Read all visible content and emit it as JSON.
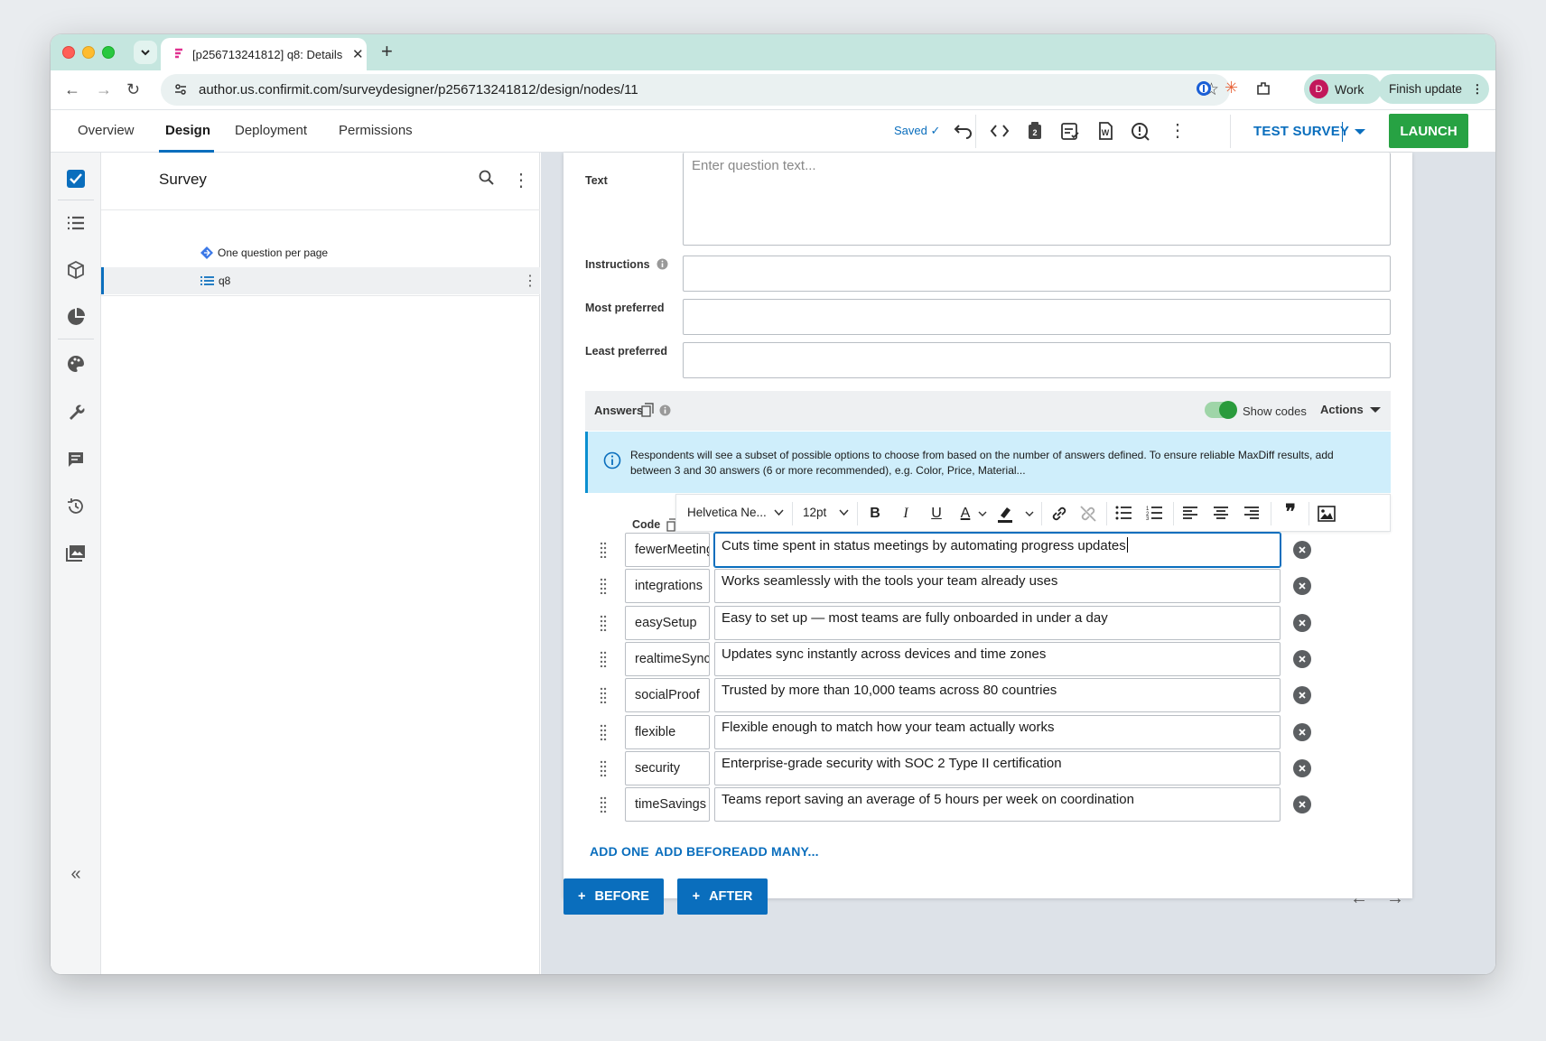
{
  "browser": {
    "tab_title": "[p256713241812] q8: Details",
    "url": "author.us.confirmit.com/surveydesigner/p256713241812/design/nodes/11",
    "profile_initial": "D",
    "profile_label": "Work",
    "finish_update": "Finish update"
  },
  "app": {
    "tabs": [
      "Overview",
      "Design",
      "Deployment",
      "Permissions"
    ],
    "saved": "Saved ✓",
    "test_survey": "TEST SURVEY",
    "launch": "LAUNCH"
  },
  "tree": {
    "title": "Survey",
    "nodes": [
      {
        "label": "One question per page",
        "icon": "page-break-icon"
      },
      {
        "label": "q8",
        "icon": "list-icon"
      }
    ]
  },
  "editor": {
    "fields": [
      {
        "label": "Text",
        "placeholder": "Enter question text..."
      },
      {
        "label": "Instructions",
        "placeholder": ""
      },
      {
        "label": "Most preferred",
        "placeholder": ""
      },
      {
        "label": "Least preferred",
        "placeholder": ""
      }
    ],
    "answers_label": "Answers",
    "show_codes_label": "Show codes",
    "show_codes_on": true,
    "actions_label": "Actions",
    "info_text": "Respondents will see a subset of possible options to choose from based on the number of answers defined. To ensure reliable MaxDiff results, add between 3 and 30 answers (6 or more recommended), e.g. Color, Price, Material...",
    "code_header": "Code",
    "rte": {
      "font": "Helvetica Ne...",
      "size": "12pt"
    },
    "answers": [
      {
        "code": "fewerMeetings",
        "text": "Cuts time spent in status meetings by automating progress updates"
      },
      {
        "code": "integrations",
        "text": "Works seamlessly with the tools your team already uses"
      },
      {
        "code": "easySetup",
        "text": "Easy to set up — most teams are fully onboarded in under a day"
      },
      {
        "code": "realtimeSync",
        "text": "Updates sync instantly across devices and time zones"
      },
      {
        "code": "socialProof",
        "text": "Trusted by more than 10,000 teams across 80 countries"
      },
      {
        "code": "flexible",
        "text": "Flexible enough to match how your team actually works"
      },
      {
        "code": "security",
        "text": "Enterprise-grade security with SOC 2 Type II certification"
      },
      {
        "code": "timeSavings",
        "text": "Teams report saving an average of 5 hours per week on coordination"
      }
    ],
    "add_one": "ADD ONE",
    "add_before": "ADD BEFORE",
    "add_many": "ADD MANY...",
    "before_btn": "BEFORE",
    "after_btn": "AFTER"
  },
  "colors": {
    "accent": "#0a6ebd",
    "launch": "#27a243",
    "chrome": "#c5e6df",
    "info": "#cfeefb"
  }
}
